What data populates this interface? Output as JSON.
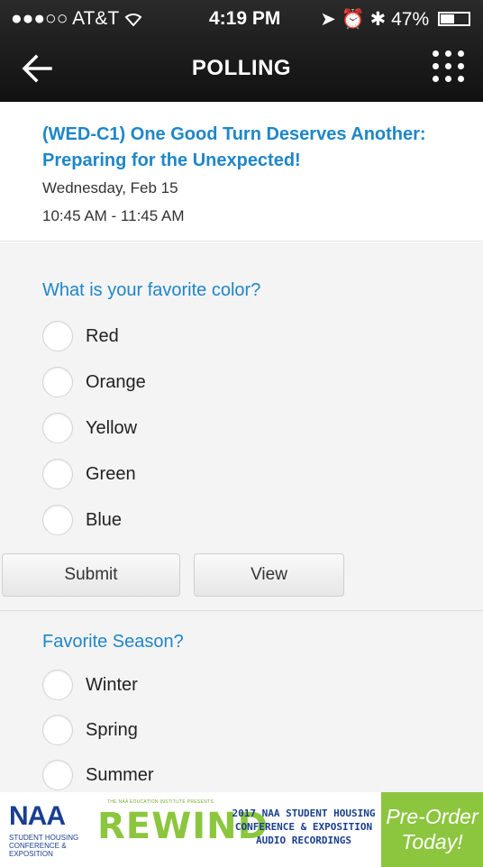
{
  "status_bar": {
    "signal": "●●●○○",
    "carrier": "AT&T",
    "time": "4:19 PM",
    "battery": "47%",
    "battery_level": 0.47
  },
  "nav": {
    "title": "POLLING"
  },
  "session": {
    "title": "(WED-C1) One Good Turn Deserves Another: Preparing for the Unexpected!",
    "date": "Wednesday, Feb 15",
    "time": "10:45 AM - 11:45 AM"
  },
  "polls": [
    {
      "question": "What is your favorite color?",
      "options": [
        "Red",
        "Orange",
        "Yellow",
        "Green",
        "Blue"
      ],
      "submit_label": "Submit",
      "view_label": "View"
    },
    {
      "question": "Favorite Season?",
      "options": [
        "Winter",
        "Spring",
        "Summer"
      ]
    }
  ],
  "banner": {
    "naa_logo": "NAA",
    "naa_sub": "STUDENT HOUSING CONFERENCE & EXPOSITION",
    "rewind_tag": "THE NAA EDUCATION INSTITUTE PRESENTS",
    "rewind_logo": "REWIND",
    "conference_lines": [
      "2017 NAA STUDENT HOUSING",
      "CONFERENCE & EXPOSITION",
      "AUDIO RECORDINGS"
    ],
    "cta": "Pre-Order\nToday!",
    "colors": {
      "navy": "#1a3f8f",
      "green": "#8cc63f"
    }
  },
  "colors": {
    "accent": "#1f86c8",
    "topbar": "#1a1a1a",
    "poll_bg": "#f4f4f4"
  }
}
